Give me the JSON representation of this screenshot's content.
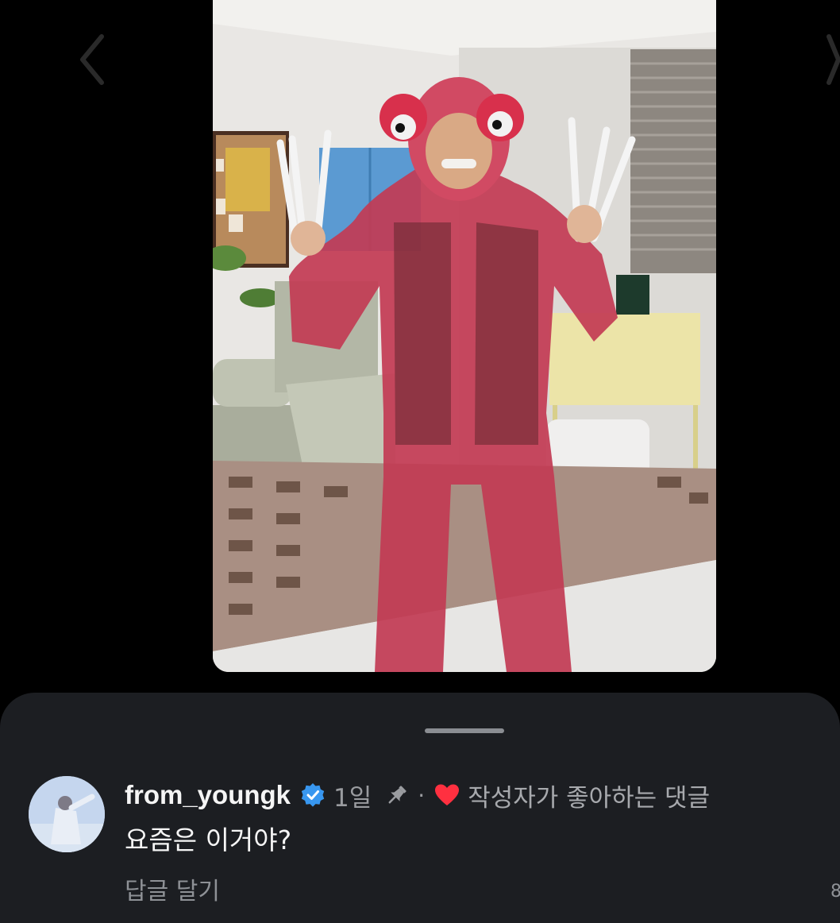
{
  "comment": {
    "username": "from_youngk",
    "age": "1일",
    "separator": "·",
    "liked_by_creator_label": "작성자가 좋아하는 댓글",
    "text": "요즘은 이거야?",
    "reply_label": "답글 달기"
  },
  "icons": {
    "back": "chevron-left-icon",
    "forward": "chevron-right-icon",
    "verified": "verified-badge-icon",
    "pin": "pin-icon",
    "heart": "heart-icon"
  },
  "colors": {
    "background": "#000000",
    "sheet": "#1c1e22",
    "verified": "#3897f0",
    "heart": "#ff3040",
    "muted_text": "#9a9ca0",
    "primary_text": "#f5f5f5"
  }
}
